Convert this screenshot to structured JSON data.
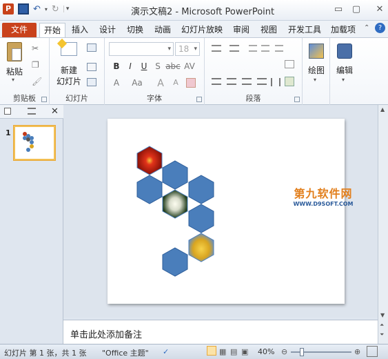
{
  "window": {
    "title": "演示文稿2 - Microsoft PowerPoint"
  },
  "tabs": [
    "文件",
    "开始",
    "插入",
    "设计",
    "切换",
    "动画",
    "幻灯片放映",
    "审阅",
    "视图",
    "开发工具",
    "加载项"
  ],
  "ribbon": {
    "clipboard": {
      "paste_label": "粘贴",
      "group_label": "剪贴板"
    },
    "slides": {
      "new_slide_label": "新建\n幻灯片",
      "new_slide_line1": "新建",
      "new_slide_line2": "幻灯片",
      "group_label": "幻灯片"
    },
    "font": {
      "size_value": "18",
      "group_label": "字体",
      "format_buttons": [
        "B",
        "I",
        "U",
        "S",
        "abc",
        "AV",
        "Aa",
        "A",
        "A",
        "A"
      ]
    },
    "paragraph": {
      "group_label": "段落"
    },
    "drawing": {
      "label": "绘图"
    },
    "editing": {
      "label": "编辑"
    }
  },
  "slides_panel": {
    "slide_number": "1"
  },
  "notes": {
    "placeholder": "单击此处添加备注"
  },
  "status": {
    "slide_info": "幻灯片 第 1 张，共 1 张",
    "theme": "\"Office 主题\"",
    "zoom": "40%"
  },
  "watermark": {
    "main": "第九软件网",
    "sub": "WWW.D9SOFT.COM"
  },
  "colors": {
    "hexagon_fill": "#4a7ebb",
    "file_tab": "#c9421c",
    "accent": "#2a5a9a"
  }
}
